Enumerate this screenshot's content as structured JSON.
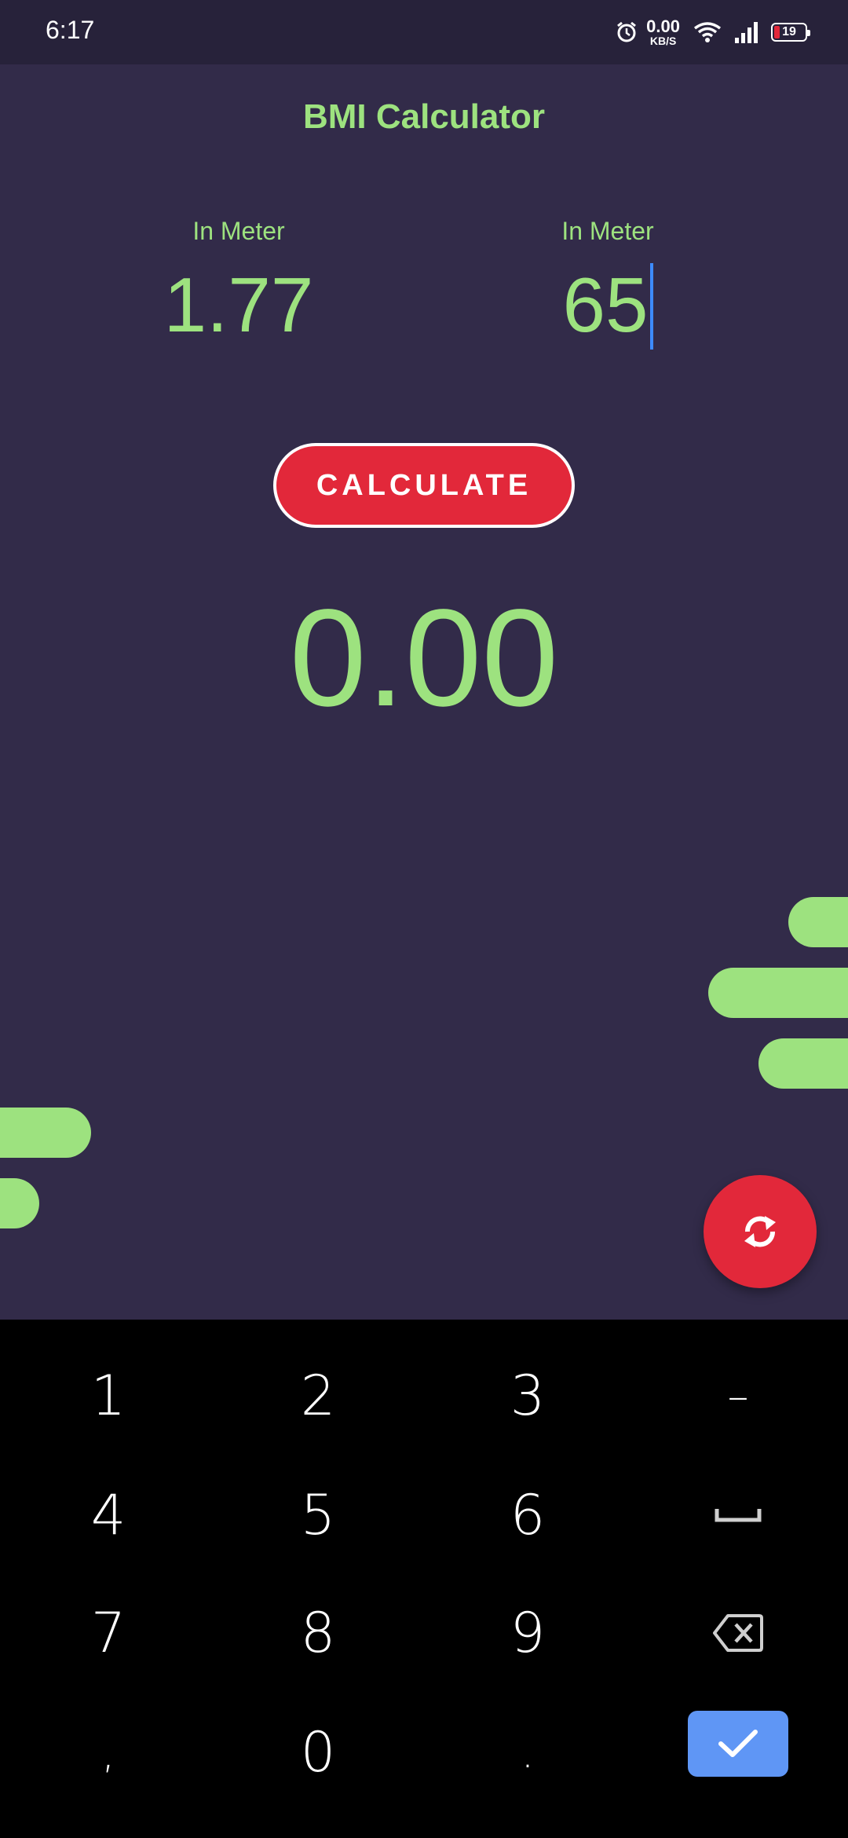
{
  "status_bar": {
    "time": "6:17",
    "net_speed_value": "0.00",
    "net_speed_unit": "KB/S",
    "battery_level": "19",
    "icons": [
      "alarm-icon",
      "wifi-icon",
      "signal-icon",
      "battery-icon"
    ]
  },
  "app": {
    "title": "BMI Calculator",
    "field_1": {
      "label": "In Meter",
      "value": "1.77"
    },
    "field_2": {
      "label": "In Meter",
      "value": "65"
    },
    "calculate_label": "CALCULATE",
    "result": "0.00",
    "fab_icon": "refresh-icon",
    "colors": {
      "background": "#322b49",
      "accent_green": "#9de27f",
      "accent_red": "#e2283a"
    }
  },
  "keyboard": {
    "row1": [
      "1",
      "2",
      "3",
      "–"
    ],
    "row2": [
      "4",
      "5",
      "6",
      "␣"
    ],
    "row3": [
      "7",
      "8",
      "9"
    ],
    "row4": [
      ",",
      "0",
      "."
    ],
    "icons": [
      "space-icon",
      "backspace-icon",
      "done-check-icon"
    ],
    "done_color": "#5f96f5"
  }
}
